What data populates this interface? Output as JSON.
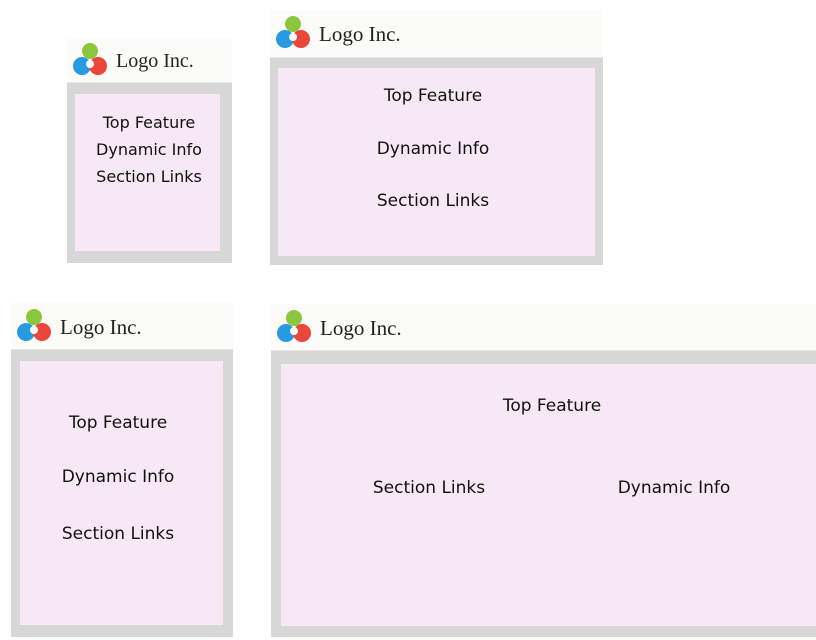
{
  "brand": {
    "logo_text": "Logo Inc.",
    "colors": {
      "green": "#8cc63f",
      "blue": "#2a9ae0",
      "red": "#e8473b",
      "content_bg": "#f7e8f6",
      "frame": "#d7d7d7"
    }
  },
  "layouts": [
    {
      "id": "small-narrow",
      "items": [
        "Top Feature",
        "Dynamic Info",
        "Section Links"
      ]
    },
    {
      "id": "medium",
      "items": [
        "Top Feature",
        "Dynamic Info",
        "Section Links"
      ]
    },
    {
      "id": "tall-narrow",
      "items": [
        "Top Feature",
        "Dynamic Info",
        "Section Links"
      ]
    },
    {
      "id": "wide",
      "items": [
        "Top Feature",
        "Section Links",
        "Dynamic Info"
      ]
    }
  ]
}
